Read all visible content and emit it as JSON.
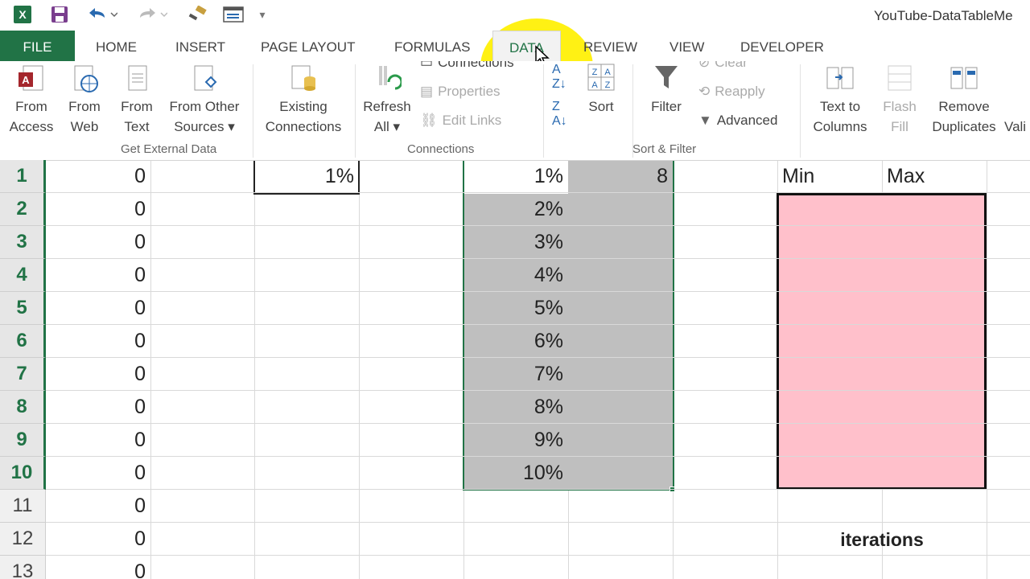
{
  "title_bar": {
    "document_title": "YouTube-DataTableMe",
    "icons": [
      "excel-icon",
      "save-icon",
      "undo-icon",
      "redo-icon",
      "format-painter-icon",
      "form-icon",
      "customize-icon"
    ]
  },
  "tabs": [
    "FILE",
    "HOME",
    "INSERT",
    "PAGE LAYOUT",
    "FORMULAS",
    "DATA",
    "REVIEW",
    "VIEW",
    "DEVELOPER"
  ],
  "active_tab": "DATA",
  "ribbon": {
    "get_external_data": {
      "group_label": "Get External Data",
      "from_access": [
        "From",
        "Access"
      ],
      "from_web": [
        "From",
        "Web"
      ],
      "from_text": [
        "From",
        "Text"
      ],
      "from_other": [
        "From Other",
        "Sources ▾"
      ],
      "existing": [
        "Existing",
        "Connections"
      ]
    },
    "connections": {
      "group_label": "Connections",
      "refresh": [
        "Refresh",
        "All ▾"
      ],
      "connections": "Connections",
      "properties": "Properties",
      "edit_links": "Edit Links"
    },
    "sort_filter": {
      "group_label": "Sort & Filter",
      "sort": "Sort",
      "filter": "Filter",
      "clear": "Clear",
      "reapply": "Reapply",
      "advanced": "Advanced"
    },
    "data_tools": {
      "text_to_columns": [
        "Text to",
        "Columns"
      ],
      "flash_fill": [
        "Flash",
        "Fill"
      ],
      "remove_duplicates": [
        "Remove",
        "Duplicates"
      ],
      "validation": [
        "",
        "Vali"
      ]
    }
  },
  "sheet": {
    "row_numbers": [
      "1",
      "2",
      "3",
      "4",
      "5",
      "6",
      "7",
      "8",
      "9",
      "10",
      "11",
      "12",
      "13"
    ],
    "col_a_values": [
      "0",
      "0",
      "0",
      "0",
      "0",
      "0",
      "0",
      "0",
      "0",
      "0",
      "0",
      "0",
      "0"
    ],
    "input_cell": "1%",
    "table_percent": [
      "1%",
      "2%",
      "3%",
      "4%",
      "5%",
      "6%",
      "7%",
      "8%",
      "9%",
      "10%"
    ],
    "table_top_result": "8",
    "min_label": "Min",
    "max_label": "Max",
    "iterations_label": "iterations",
    "colors": {
      "accent": "#217346",
      "pink_box": "#ffc0cb",
      "table_shade": "#bfbfbf",
      "highlight": "#fff000"
    }
  }
}
